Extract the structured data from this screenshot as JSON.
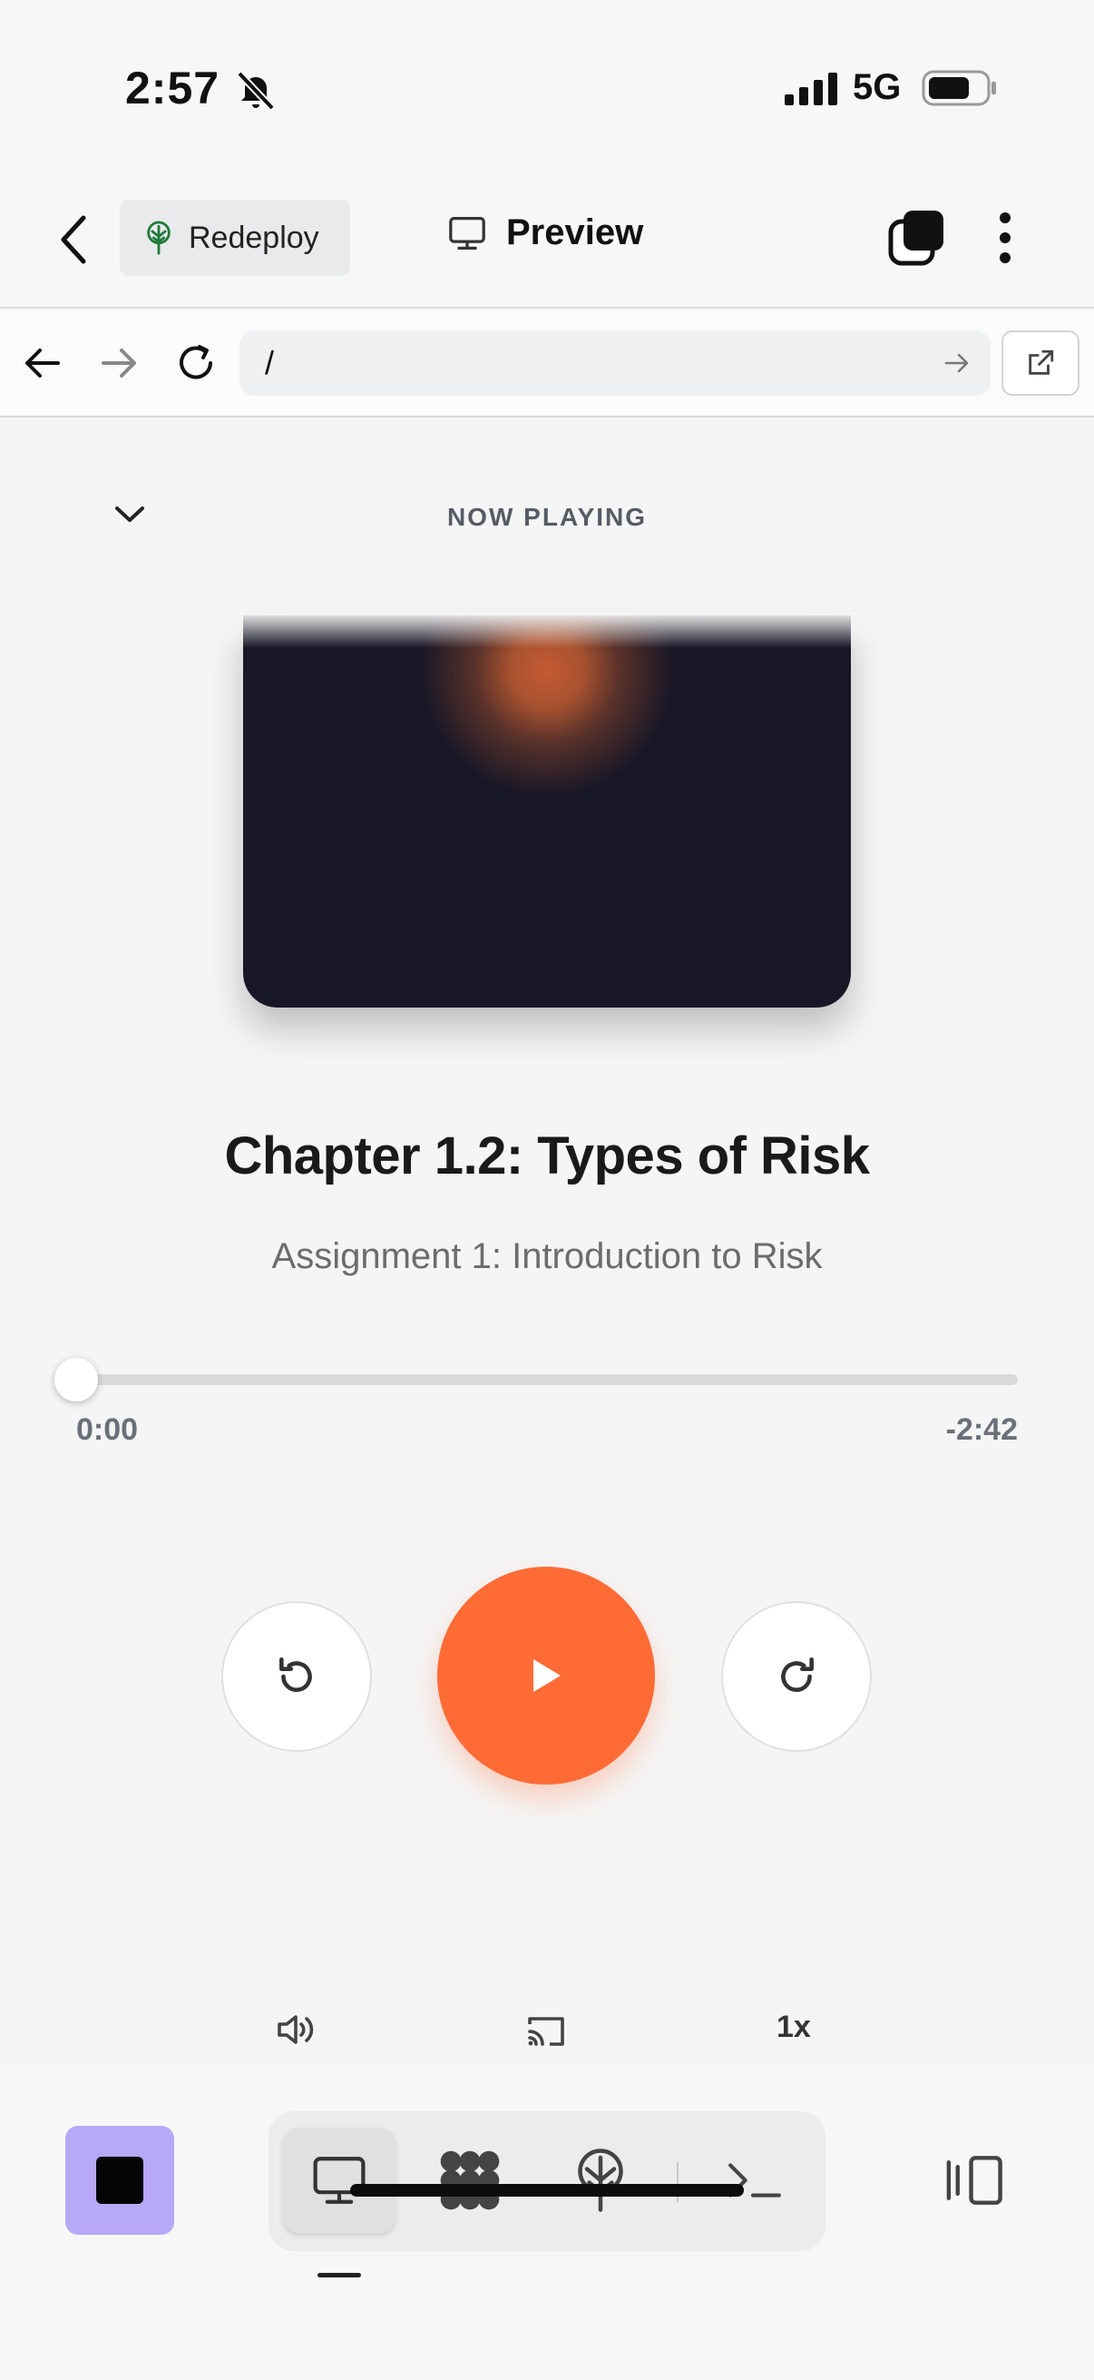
{
  "status_bar": {
    "time": "2:57",
    "network": "5G"
  },
  "header": {
    "redeploy_label": "Redeploy",
    "preview_label": "Preview"
  },
  "url_bar": {
    "url": "/"
  },
  "player": {
    "section_label": "NOW PLAYING",
    "title": "Chapter 1.2: Types of Risk",
    "subtitle": "Assignment 1: Introduction to Risk",
    "elapsed": "0:00",
    "remaining": "-2:42",
    "progress_fraction": 0.0,
    "speed": "1x",
    "accent_color": "#ff6b35"
  },
  "bottom_bar": {
    "stop_color": "#b7a8f8",
    "tools": [
      "desktop-icon",
      "network-icon",
      "deploy-icon",
      "terminal-icon"
    ]
  }
}
